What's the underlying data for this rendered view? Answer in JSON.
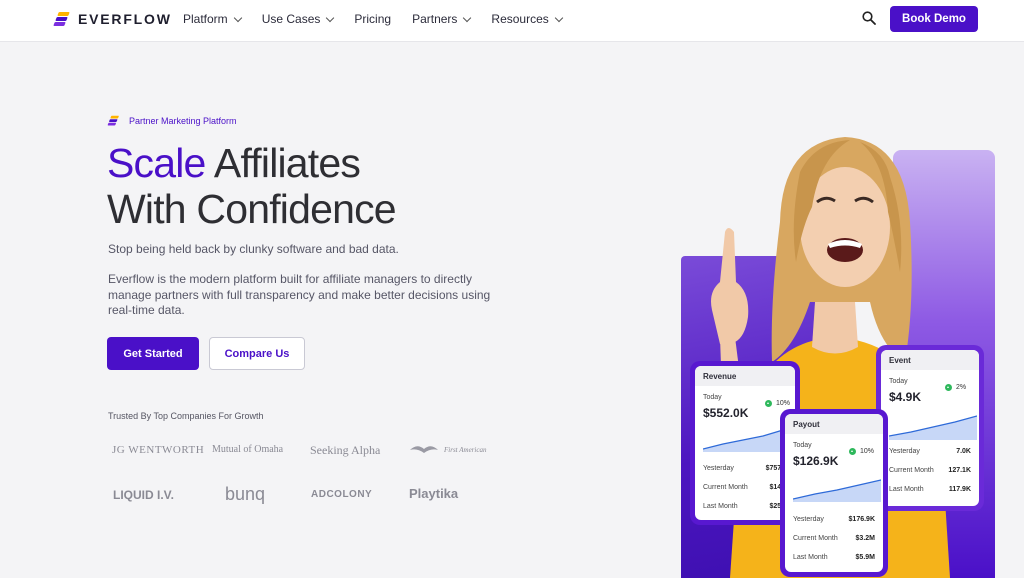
{
  "nav": {
    "brand": "EVERFLOW",
    "items": [
      {
        "label": "Platform",
        "has_dropdown": true
      },
      {
        "label": "Use Cases",
        "has_dropdown": true
      },
      {
        "label": "Pricing",
        "has_dropdown": false
      },
      {
        "label": "Partners",
        "has_dropdown": true
      },
      {
        "label": "Resources",
        "has_dropdown": true
      }
    ],
    "search_icon": "search-icon",
    "cta": "Book Demo"
  },
  "hero": {
    "badge": "Partner Marketing Platform",
    "title_accent": "Scale",
    "title_rest_line1": " Affiliates",
    "title_line2": "With Confidence",
    "subtitle": "Stop being held back by clunky software and bad data.",
    "description": "Everflow is the modern platform built for affiliate managers to directly manage partners with full transparency and make better decisions using real-time data.",
    "primary_cta": "Get Started",
    "secondary_cta": "Compare Us",
    "trusted_label": "Trusted By Top Companies For Growth",
    "brands": [
      "JG WENTWORTH",
      "Mutual of Omaha",
      "Seeking Alpha",
      "First American",
      "LIQUID I.V.",
      "bunq",
      "ADCOLONY",
      "Playtika"
    ]
  },
  "cards": {
    "revenue": {
      "title": "Revenue",
      "today_label": "Today",
      "value": "$552.0K",
      "pct": "10%",
      "rows": [
        [
          "Yesterday",
          "$757.4"
        ],
        [
          "Current Month",
          "$14.1"
        ],
        [
          "Last Month",
          "$25.9"
        ]
      ]
    },
    "payout": {
      "title": "Payout",
      "today_label": "Today",
      "value": "$126.9K",
      "pct": "10%",
      "rows": [
        [
          "Yesterday",
          "$176.9K"
        ],
        [
          "Current Month",
          "$3.2M"
        ],
        [
          "Last Month",
          "$5.9M"
        ]
      ]
    },
    "event": {
      "title": "Event",
      "today_label": "Today",
      "value": "$4.9K",
      "pct": "2%",
      "rows": [
        [
          "Yesterday",
          "7.0K"
        ],
        [
          "Current Month",
          "127.1K"
        ],
        [
          "Last Month",
          "117.9K"
        ]
      ]
    }
  },
  "colors": {
    "accent": "#4a10c8",
    "brand_yellow": "#ffb400",
    "positive": "#2eb85c"
  }
}
